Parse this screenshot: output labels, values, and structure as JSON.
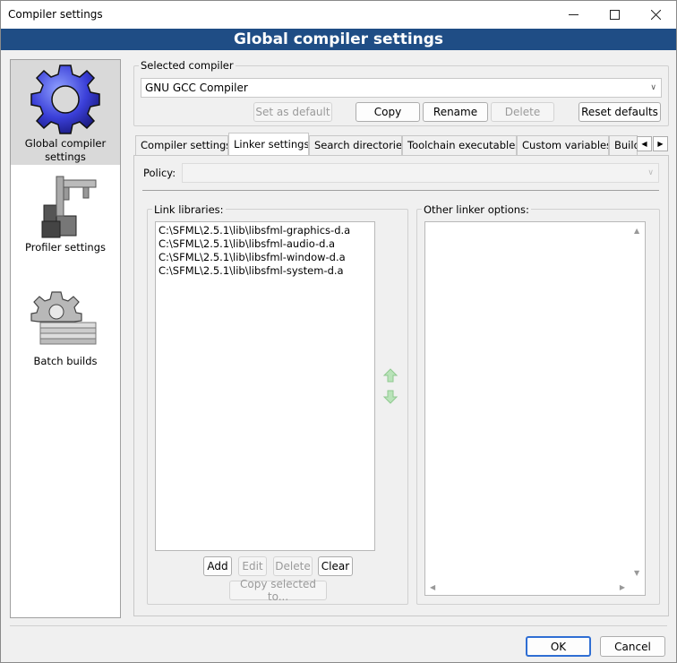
{
  "window": {
    "title": "Compiler settings",
    "banner": "Global compiler settings"
  },
  "sidebar": {
    "items": [
      {
        "label": "Global compiler settings",
        "icon": "gear-icon",
        "selected": true
      },
      {
        "label": "Profiler settings",
        "icon": "profiler-icon",
        "selected": false
      },
      {
        "label": "Batch builds",
        "icon": "batch-builds-icon",
        "selected": false
      }
    ]
  },
  "compiler": {
    "group_label": "Selected compiler",
    "selected": "GNU GCC Compiler",
    "buttons": {
      "set_default": "Set as default",
      "copy": "Copy",
      "rename": "Rename",
      "delete": "Delete",
      "reset": "Reset defaults"
    }
  },
  "tabs": [
    {
      "label": "Compiler settings",
      "active": false
    },
    {
      "label": "Linker settings",
      "active": true
    },
    {
      "label": "Search directories",
      "active": false
    },
    {
      "label": "Toolchain executables",
      "active": false
    },
    {
      "label": "Custom variables",
      "active": false
    },
    {
      "label": "Build",
      "active": false
    }
  ],
  "policy": {
    "label": "Policy:",
    "value": ""
  },
  "link_libraries": {
    "label": "Link libraries:",
    "items": [
      "C:\\SFML\\2.5.1\\lib\\libsfml-graphics-d.a",
      "C:\\SFML\\2.5.1\\lib\\libsfml-audio-d.a",
      "C:\\SFML\\2.5.1\\lib\\libsfml-window-d.a",
      "C:\\SFML\\2.5.1\\lib\\libsfml-system-d.a"
    ],
    "buttons": {
      "add": "Add",
      "edit": "Edit",
      "delete": "Delete",
      "clear": "Clear",
      "copy_selected": "Copy selected to..."
    }
  },
  "other_options": {
    "label": "Other linker options:"
  },
  "footer": {
    "ok": "OK",
    "cancel": "Cancel"
  },
  "colors": {
    "banner": "#1f4d85",
    "primary_border": "#2f6ed3",
    "arrow_green": "#5cbf5c"
  }
}
